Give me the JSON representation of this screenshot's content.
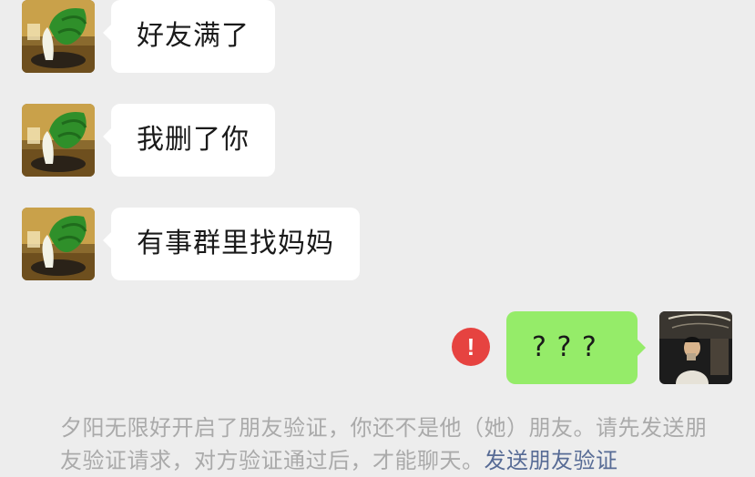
{
  "messages": [
    {
      "side": "left",
      "text": "好友满了"
    },
    {
      "side": "left",
      "text": "我删了你"
    },
    {
      "side": "left",
      "text": "有事群里找妈妈"
    },
    {
      "side": "right",
      "text": "? ? ?",
      "status": "failed"
    }
  ],
  "error_icon_glyph": "!",
  "system_note": {
    "text": "夕阳无限好开启了朋友验证，你还不是他（她）朋友。请先发送朋友验证请求，对方验证通过后，才能聊天。",
    "link_text": "发送朋友验证"
  },
  "colors": {
    "background": "#ededed",
    "left_bubble": "#ffffff",
    "right_bubble": "#95ec69",
    "error": "#e64340",
    "system_text": "#aaaaaa",
    "link": "#576b95"
  },
  "icons": {
    "contact_avatar": "bok-choy-plant-avatar",
    "self_avatar": "person-photo-avatar",
    "status": "exclamation-circle-icon"
  }
}
